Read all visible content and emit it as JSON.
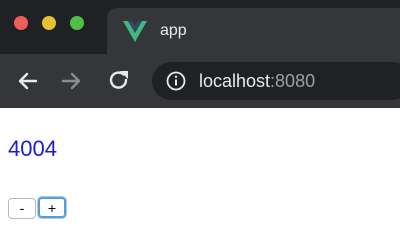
{
  "browser": {
    "tab": {
      "title": "app",
      "favicon": "vue-logo-icon"
    },
    "toolbar": {
      "back_icon": "arrow-left-icon",
      "forward_icon": "arrow-right-icon",
      "reload_icon": "reload-icon",
      "site_info_icon": "info-icon"
    },
    "address": {
      "host": "localhost",
      "port": ":8080"
    },
    "window_controls": [
      "close",
      "minimize",
      "maximize"
    ]
  },
  "app": {
    "counter": "4004",
    "decrement_label": "-",
    "increment_label": "+"
  },
  "colors": {
    "counter_text": "#1a1ad8",
    "focus_ring": "#5b9dd9",
    "vue_green": "#41b883",
    "vue_dark": "#35495e"
  }
}
